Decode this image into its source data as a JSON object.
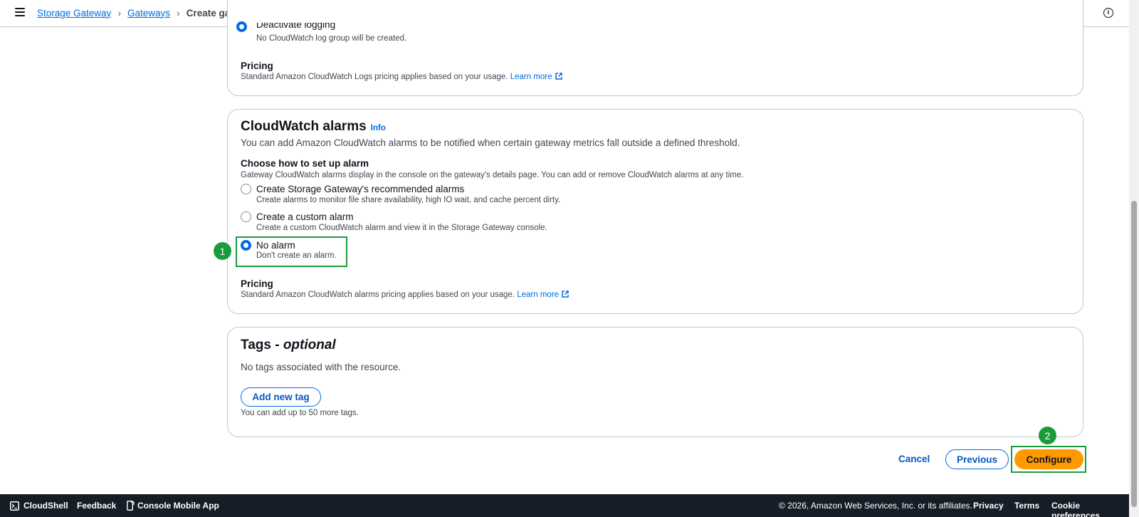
{
  "header": {
    "breadcrumb": [
      "Storage Gateway",
      "Gateways"
    ],
    "current": "Create gateway",
    "info_symbol": "i"
  },
  "logging_panel": {
    "selected_option_label": "Deactivate logging",
    "selected_option_desc": "No CloudWatch log group will be created.",
    "pricing_label": "Pricing",
    "pricing_text": "Standard Amazon CloudWatch Logs pricing applies based on your usage.",
    "learn_more": "Learn more"
  },
  "alarms_panel": {
    "title": "CloudWatch alarms",
    "info": "Info",
    "description": "You can add Amazon CloudWatch alarms to be notified when certain gateway metrics fall outside a defined threshold.",
    "choose_label": "Choose how to set up alarm",
    "choose_hint": "Gateway CloudWatch alarms display in the console on the gateway's details page. You can add or remove CloudWatch alarms at any time.",
    "options": [
      {
        "label": "Create Storage Gateway's recommended alarms",
        "desc": "Create alarms to monitor file share availability, high IO wait, and cache percent dirty.",
        "checked": false
      },
      {
        "label": "Create a custom alarm",
        "desc": "Create a custom CloudWatch alarm and view it in the Storage Gateway console.",
        "checked": false
      },
      {
        "label": "No alarm",
        "desc": "Don't create an alarm.",
        "checked": true
      }
    ],
    "pricing_label": "Pricing",
    "pricing_text": "Standard Amazon CloudWatch alarms pricing applies based on your usage.",
    "learn_more": "Learn more"
  },
  "tags_panel": {
    "title": "Tags - ",
    "title_optional": "optional",
    "empty_text": "No tags associated with the resource.",
    "add_button": "Add new tag",
    "limit_text": "You can add up to 50 more tags."
  },
  "actions": {
    "cancel": "Cancel",
    "previous": "Previous",
    "configure": "Configure"
  },
  "annotations": {
    "badge_1": "1",
    "badge_2": "2",
    "color": "#1a9c3d"
  },
  "footer": {
    "cloudshell": "CloudShell",
    "feedback": "Feedback",
    "mobile_app": "Console Mobile App",
    "copyright": "© 2026, Amazon Web Services, Inc. or its affiliates.",
    "privacy": "Privacy",
    "terms": "Terms",
    "cookie": "Cookie preferences"
  },
  "colors": {
    "link": "#006ce0",
    "primary_button": "#ff9900",
    "footer_bg": "#161d26"
  }
}
